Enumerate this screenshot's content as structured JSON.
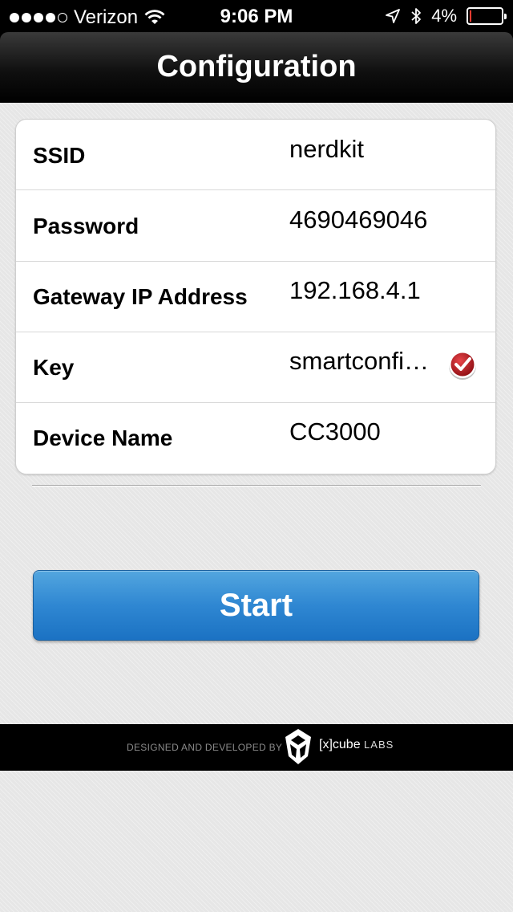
{
  "status_bar": {
    "carrier": "Verizon",
    "time": "9:06 PM",
    "battery": "4%",
    "battery_level": 0.04,
    "icons": [
      "signal-dots-icon",
      "wifi-icon",
      "location-arrow-icon",
      "bluetooth-icon",
      "battery-icon"
    ]
  },
  "nav": {
    "title": "Configuration"
  },
  "form": {
    "rows": [
      {
        "label": "SSID",
        "value": "nerdkit"
      },
      {
        "label": "Password",
        "value": "4690469046"
      },
      {
        "label": "Gateway IP Address",
        "value": "192.168.4.1"
      },
      {
        "label": "Key",
        "value": "smartconfi…"
      },
      {
        "label": "Device Name",
        "value": "CC3000"
      }
    ],
    "key_checked": true,
    "check_color": "#c0141b"
  },
  "start_button": {
    "label": "Start",
    "color": "#2f87d2"
  },
  "footer": {
    "credit": "DESIGNED AND DEVELOPED BY",
    "brand": "[x]cube",
    "brand_suffix": "LABS"
  }
}
